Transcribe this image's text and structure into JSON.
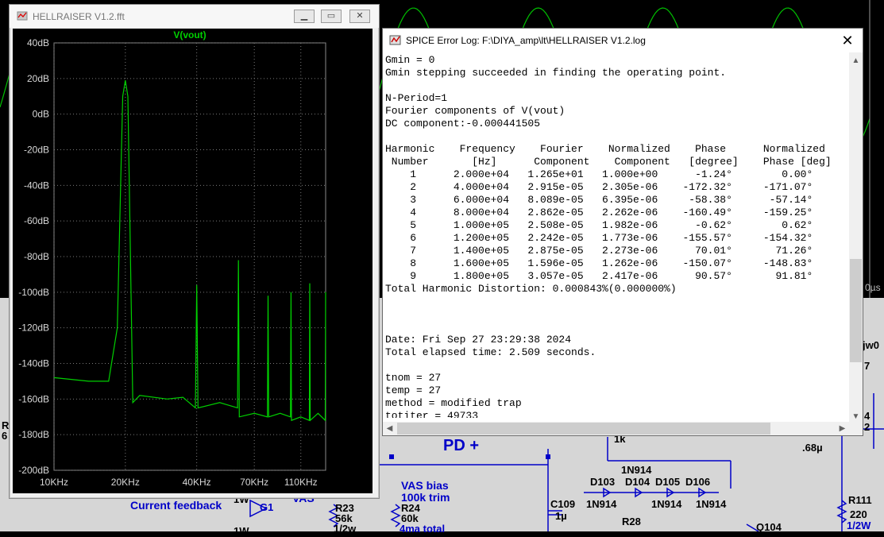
{
  "fft_window": {
    "title": "HELLRAISER V1.2.fft",
    "trace_label": "V(vout)",
    "y_ticks": [
      "40dB",
      "20dB",
      "0dB",
      "-20dB",
      "-40dB",
      "-60dB",
      "-80dB",
      "-100dB",
      "-120dB",
      "-140dB",
      "-160dB",
      "-180dB",
      "-200dB"
    ],
    "x_ticks": [
      "10KHz",
      "20KHz",
      "40KHz",
      "70KHz",
      "110KHz"
    ],
    "trace_color": "#00d000"
  },
  "chart_data": {
    "type": "line",
    "ylabel": "",
    "xlabel": "",
    "ylim": [
      -200,
      40
    ],
    "x_scale": "log",
    "xlim_khz": [
      10,
      140
    ],
    "series": [
      {
        "x": [
          10,
          14,
          17,
          18.5,
          19.5,
          20,
          20.5,
          21.5,
          23,
          30,
          35,
          39.5,
          40,
          40.5,
          50,
          59.5,
          60,
          60.5,
          70,
          79.5,
          80,
          80.5,
          90,
          99.5,
          100,
          100.5,
          110,
          119.5,
          120,
          120.5,
          130,
          139.5,
          140
        ],
        "y": [
          -148,
          -150,
          -150,
          -120,
          10,
          19,
          10,
          -162,
          -158,
          -160,
          -159,
          -165,
          -96,
          -165,
          -162,
          -165,
          -82,
          -170,
          -168,
          -170,
          -102,
          -170,
          -168,
          -170,
          -100,
          -172,
          -170,
          -172,
          -95,
          -172,
          -168,
          -172,
          -100
        ]
      }
    ]
  },
  "log_window": {
    "title": "SPICE Error Log: F:\\DIYA_amp\\lt\\HELLRAISER V1.2.log",
    "lines": [
      "Gmin = 0",
      "Gmin stepping succeeded in finding the operating point.",
      "",
      "N-Period=1",
      "Fourier components of V(vout)",
      "DC component:-0.000441505",
      "",
      "Harmonic    Frequency    Fourier    Normalized    Phase      Normalized",
      " Number       [Hz]      Component    Component   [degree]    Phase [deg]",
      "    1      2.000e+04   1.265e+01   1.000e+00      -1.24°        0.00°",
      "    2      4.000e+04   2.915e-05   2.305e-06    -172.32°     -171.07°",
      "    3      6.000e+04   8.089e-05   6.395e-06     -58.38°      -57.14°",
      "    4      8.000e+04   2.862e-05   2.262e-06    -160.49°     -159.25°",
      "    5      1.000e+05   2.508e-05   1.982e-06      -0.62°        0.62°",
      "    6      1.200e+05   2.242e-05   1.773e-06    -155.57°     -154.32°",
      "    7      1.400e+05   2.875e-05   2.273e-06      70.01°       71.26°",
      "    8      1.600e+05   1.596e-05   1.262e-06    -150.07°     -148.83°",
      "    9      1.800e+05   3.057e-05   2.417e-06      90.57°       91.81°",
      "Total Harmonic Distortion: 0.000843%(0.000000%)",
      "",
      "",
      "",
      "Date: Fri Sep 27 23:29:38 2024",
      "Total elapsed time: 2.509 seconds.",
      "",
      "tnom = 27",
      "temp = 27",
      "method = modified trap",
      "totiter = 49733"
    ]
  },
  "schematic": {
    "labels": {
      "pd_plus": "PD +",
      "vas_bias": "VAS bias",
      "trim": "100k trim",
      "current_feedback": "Current feedback",
      "g1": "G1",
      "vas": "VAS",
      "r23": "R23",
      "r23_val": "56k",
      "r23_pow": "1/2w",
      "r24": "R24",
      "r24_val": "60k",
      "ma_total": "4ma total",
      "c109": "C109",
      "c109_val": "1µ",
      "one_k": "1k",
      "d_1n914_top": "1N914",
      "d103": "D103",
      "d104": "D104",
      "d105": "D105",
      "d106": "D106",
      "d_1n914_a": "1N914",
      "d_1n914_b": "1N914",
      "d_1n914_c": "1N914",
      "r28": "R28",
      "q104": "Q104",
      "cap68": ".68µ",
      "r111": "R111",
      "r111_val": "220",
      "r111_pow": "1/2W",
      "jw0": "jw0",
      "seven": "7",
      "four": "4",
      "two": "2",
      "one_w_a": "1W",
      "one_w_b": "1W",
      "r_left": "R",
      "six_left": "6",
      "time_tick": "0µs"
    }
  }
}
